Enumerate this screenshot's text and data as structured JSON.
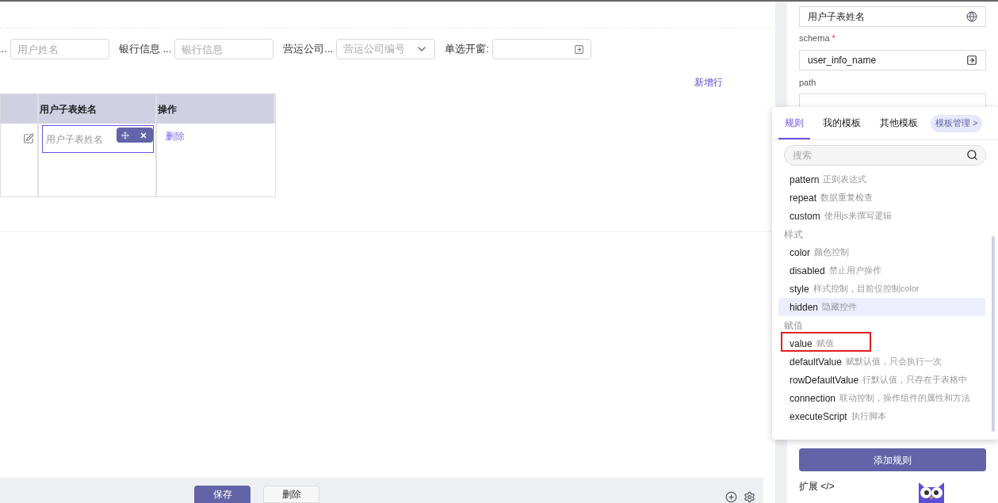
{
  "form": {
    "fields": [
      {
        "label": "...",
        "kind": "input",
        "placeholder": "用户姓名"
      },
      {
        "label": "银行信息 ...",
        "kind": "input",
        "placeholder": "银行信息"
      },
      {
        "label": "营运公司...",
        "kind": "select",
        "placeholder": "营运公司编号"
      },
      {
        "label": "单选开窗:",
        "kind": "popup"
      }
    ]
  },
  "add_row_link": "新增行",
  "table": {
    "columns": [
      "",
      "用户子表姓名",
      "操作"
    ],
    "rows": [
      {
        "placeholder": "用户子表姓名",
        "action": "删除",
        "editing": true
      }
    ]
  },
  "footer": {
    "buttons": [
      {
        "label": "保存",
        "primary": true
      },
      {
        "label": "删除",
        "primary": false
      }
    ]
  },
  "properties": {
    "title_field": {
      "value": "用户子表姓名"
    },
    "schema": {
      "label": "schema",
      "required_mark": "*",
      "value": "user_info_name"
    },
    "path": {
      "label": "path"
    },
    "add_rule_button": "添加规则",
    "extension": "扩展 </>"
  },
  "rule_popup": {
    "tabs": [
      {
        "label": "规则",
        "selected": true
      },
      {
        "label": "我的模板",
        "selected": false
      },
      {
        "label": "其他模板",
        "selected": false
      }
    ],
    "manage_button": "模板管理 >",
    "search": {
      "placeholder": "搜索"
    },
    "groups": [
      {
        "items": [
          {
            "name": "pattern",
            "desc": "正则表达式",
            "highlighted": false,
            "marked": false
          },
          {
            "name": "repeat",
            "desc": "数据重复检查",
            "highlighted": false,
            "marked": false
          },
          {
            "name": "custom",
            "desc": "使用js来撰写逻辑",
            "highlighted": false,
            "marked": false
          }
        ]
      },
      {
        "title": "样式",
        "items": [
          {
            "name": "color",
            "desc": "颜色控制",
            "highlighted": false,
            "marked": false
          },
          {
            "name": "disabled",
            "desc": "禁止用户操作",
            "highlighted": false,
            "marked": false
          },
          {
            "name": "style",
            "desc": "样式控制，目前仅控制color",
            "highlighted": false,
            "marked": false
          },
          {
            "name": "hidden",
            "desc": "隐藏控件",
            "highlighted": true,
            "marked": false
          }
        ]
      },
      {
        "title": "赋值",
        "items": [
          {
            "name": "value",
            "desc": "赋值",
            "highlighted": false,
            "marked": true
          },
          {
            "name": "defaultValue",
            "desc": "赋默认值，只会执行一次",
            "highlighted": false,
            "marked": false
          },
          {
            "name": "rowDefaultValue",
            "desc": "行默认值，只存在于表格中",
            "highlighted": false,
            "marked": false
          },
          {
            "name": "connection",
            "desc": "联动控制，操作组件的属性和方法",
            "highlighted": false,
            "marked": false
          },
          {
            "name": "executeScript",
            "desc": "执行脚本",
            "highlighted": false,
            "marked": false
          }
        ]
      }
    ]
  }
}
